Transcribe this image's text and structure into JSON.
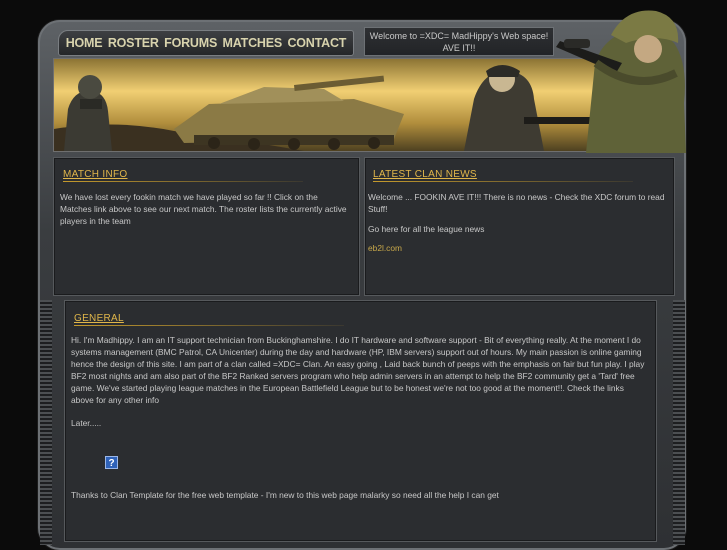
{
  "nav": {
    "items": [
      "HOME",
      "ROSTER",
      "FORUMS",
      "MATCHES",
      "CONTACT"
    ]
  },
  "welcome": {
    "line1": "Welcome to =XDC= MadHippy's Web space!",
    "line2": "AVE IT!!"
  },
  "match_info": {
    "title": "MATCH INFO",
    "text": "We have lost every fookin match we have played so far !! Click on the Matches link above to see our next match.  The roster lists the currently active players in the team"
  },
  "latest_news": {
    "title": "LATEST CLAN NEWS",
    "text1": "Welcome ...  FOOKIN AVE IT!!!  There is no news - Check the XDC forum to read Stuff!",
    "text2": "Go here for all the league news",
    "link": "eb2l.com"
  },
  "general": {
    "title": "GENERAL",
    "intro": "Hi. I'm Madhippy.  I am an IT support technician from Buckinghamshire.  I do IT hardware and software support - Bit of everything really.  At the moment I do systems management (BMC Patrol, CA Unicenter) during the day and hardware (HP, IBM servers) support out of hours.  My main passion is online gaming hence the design of this site.  I am part of a clan called =XDC= Clan.  An easy going , Laid back bunch of peeps with the emphasis on fair but fun play.  I play BF2 most nights and am also part of the BF2 Ranked servers program who help admin servers in an attempt to help the BF2 community get a 'Tard' free game.  We've started playing league matches in the European Battlefield League but to be honest we're not too good at the moment!!.  Check the links above for any other info",
    "later": "Later.....",
    "image_icon": "broken-image-icon",
    "thanks": "Thanks to Clan Template for the free web template - I'm new to this web page malarky so need all the help I can get"
  },
  "colors": {
    "accent": "#e0b64a",
    "text": "#c8c8c8",
    "panel": "#2b2d30",
    "nav_text": "#d8d3ad"
  }
}
